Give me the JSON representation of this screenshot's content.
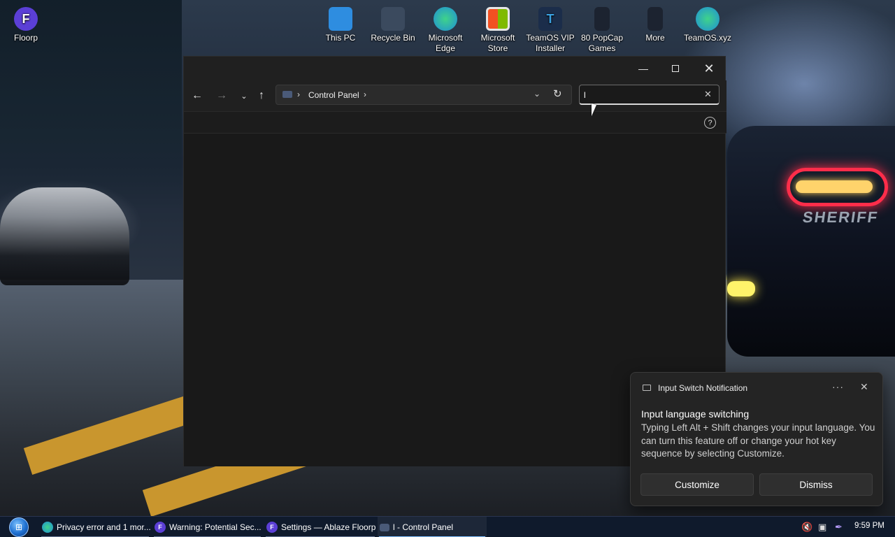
{
  "desktop": {
    "icons": [
      {
        "name": "floorp",
        "label": "Floorp",
        "color": "#5b3fd6"
      },
      {
        "name": "this-pc",
        "label": "This PC",
        "color": "#2e8de0"
      },
      {
        "name": "recycle-bin",
        "label": "Recycle Bin",
        "color": "#3b4a5e"
      },
      {
        "name": "microsoft-edge",
        "label": "Microsoft Edge",
        "color": "#1fa3c8"
      },
      {
        "name": "microsoft-store",
        "label": "Microsoft Store",
        "color": "#e6e6e6"
      },
      {
        "name": "teamos-vip-installer",
        "label": "TeamOS VIP Installer",
        "color": "#3aa0e0"
      },
      {
        "name": "80-popcap-games",
        "label": "80 PopCap Games",
        "color": "#1c2330"
      },
      {
        "name": "more",
        "label": "More",
        "color": "#1c2330"
      },
      {
        "name": "teamos-xyz",
        "label": "TeamOS.xyz",
        "color": "#1fa3c8"
      }
    ]
  },
  "explorer": {
    "breadcrumb": [
      "Control Panel"
    ],
    "search_value": "l",
    "icons": {
      "minimize": "minimize-icon",
      "maximize": "maximize-icon",
      "close": "close-icon",
      "back": "arrow-left-icon",
      "forward": "arrow-right-icon",
      "recent": "chevron-down-icon",
      "up": "arrow-up-icon",
      "refresh": "refresh-icon",
      "help": "help-icon"
    }
  },
  "notification": {
    "app_name": "Input Switch Notification",
    "title": "Input language switching",
    "body": "Typing Left Alt + Shift changes your input language. You can turn this feature off or change your hot key sequence by selecting Customize.",
    "customize_label": "Customize",
    "dismiss_label": "Dismiss"
  },
  "taskbar": {
    "items": [
      {
        "label": "Privacy error and 1 mor...",
        "icon": "edge-icon",
        "active": false
      },
      {
        "label": "Warning: Potential Sec...",
        "icon": "floorp-icon",
        "active": false
      },
      {
        "label": "Settings — Ablaze Floorp",
        "icon": "floorp-icon",
        "active": false
      },
      {
        "label": "l - Control Panel",
        "icon": "control-panel-icon",
        "active": true
      }
    ],
    "clock": "9:59 PM"
  },
  "colors": {
    "window_bg": "#191919",
    "titlebar_bg": "#202020",
    "taskbar_bg": "#0f1a2c",
    "toast_bg": "#242424",
    "active_accent": "#7fc0ff"
  }
}
